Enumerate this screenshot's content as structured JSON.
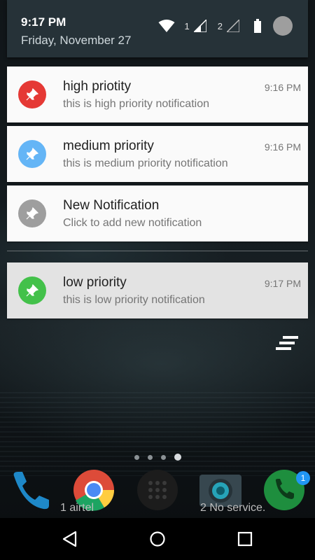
{
  "status_bar": {
    "time": "9:17 PM",
    "date": "Friday, November 27",
    "sim1_label": "1",
    "sim2_label": "2"
  },
  "notifications": [
    {
      "title": "high priotity",
      "text": "this is high priority notification",
      "time": "9:16 PM",
      "color": "#e53935",
      "icon": "pin-icon"
    },
    {
      "title": "medium priority",
      "text": "this is medium priority notification",
      "time": "9:16 PM",
      "color": "#64b5f6",
      "icon": "pin-icon"
    },
    {
      "title": "New Notification",
      "text": "Click to add new notification",
      "time": "",
      "color": "#9e9e9e",
      "icon": "pin-icon"
    },
    {
      "title": "low priority",
      "text": "this is low priority notification",
      "time": "9:17 PM",
      "color": "#43c14a",
      "icon": "pin-icon"
    }
  ],
  "home": {
    "sim1_status": "1 airtel",
    "sim2_status": "2 No service.",
    "phone_badge": "1",
    "page_count": 4,
    "active_page": 4
  }
}
